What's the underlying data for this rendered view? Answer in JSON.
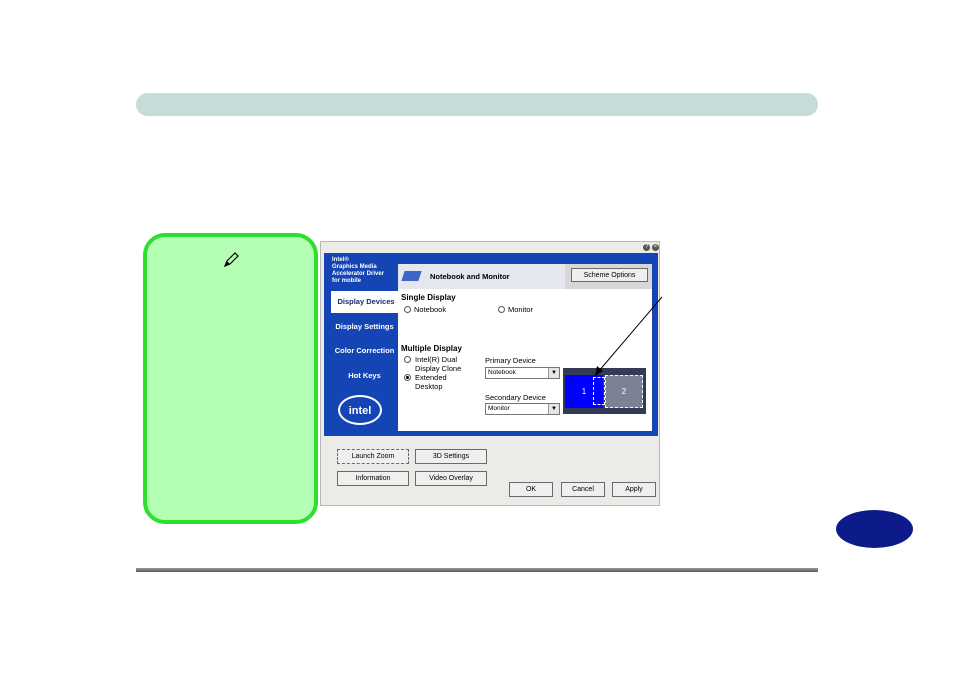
{
  "window": {
    "help_icon": "question-icon",
    "close_icon": "close-icon",
    "brand_lines": [
      "Intel®",
      "Graphics Media",
      "Accelerator Driver",
      "for mobile"
    ],
    "logo_text": "intel",
    "nav": [
      "Display Devices",
      "Display Settings",
      "Color Correction",
      "Hot Keys"
    ],
    "content_title": "Notebook and Monitor",
    "scheme_button": "Scheme Options",
    "single_display": {
      "heading": "Single Display",
      "option_notebook": "Notebook",
      "option_monitor": "Monitor"
    },
    "multiple_display": {
      "heading": "Multiple Display",
      "option_clone_line1": "Intel(R) Dual",
      "option_clone_line2": "Display Clone",
      "option_extended_line1": "Extended",
      "option_extended_line2": "Desktop",
      "selected": "Extended Desktop"
    },
    "primary_device": {
      "label": "Primary Device",
      "value": "Notebook"
    },
    "secondary_device": {
      "label": "Secondary Device",
      "value": "Monitor"
    },
    "preview": {
      "monitor1": "1",
      "monitor2": "2"
    },
    "buttons": {
      "launch_zoom": "Launch Zoom",
      "settings_3d": "3D Settings",
      "information": "Information",
      "video_overlay": "Video Overlay",
      "ok": "OK",
      "cancel": "Cancel",
      "apply": "Apply"
    }
  },
  "colors": {
    "header_bar": "#c6dcd8",
    "note_fill": "#b4ffb4",
    "note_border": "#2ee02e",
    "badge": "#0d1b8a",
    "intel_blue": "#1544b4"
  }
}
